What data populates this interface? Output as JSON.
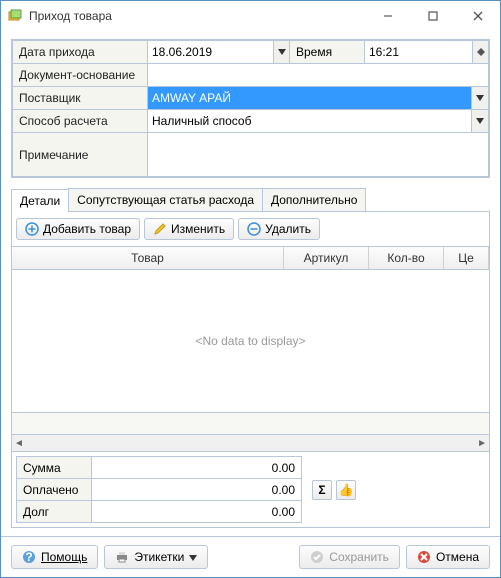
{
  "window": {
    "title": "Приход товара"
  },
  "form": {
    "date_label": "Дата прихода",
    "date_value": "18.06.2019",
    "time_label": "Время",
    "time_value": "16:21",
    "doc_basis_label": "Документ-основание",
    "doc_basis_value": "",
    "supplier_label": "Поставщик",
    "supplier_value": "AMWAY АРАЙ",
    "payment_method_label": "Способ расчета",
    "payment_method_value": "Наличный способ",
    "note_label": "Примечание",
    "note_value": ""
  },
  "tabs": {
    "details": "Детали",
    "related_expense": "Сопутствующая статья расхода",
    "additional": "Дополнительно"
  },
  "toolbar": {
    "add_product": "Добавить товар",
    "edit": "Изменить",
    "delete": "Удалить"
  },
  "grid": {
    "cols": {
      "product": "Товар",
      "article": "Артикул",
      "qty": "Кол-во",
      "price": "Це"
    },
    "empty": "<No data to display>"
  },
  "summary": {
    "sum_label": "Сумма",
    "sum_value": "0.00",
    "paid_label": "Оплачено",
    "paid_value": "0.00",
    "debt_label": "Долг",
    "debt_value": "0.00",
    "sigma": "Σ"
  },
  "footer": {
    "help": "Помощь",
    "labels": "Этикетки",
    "save": "Сохранить",
    "cancel": "Отмена"
  }
}
